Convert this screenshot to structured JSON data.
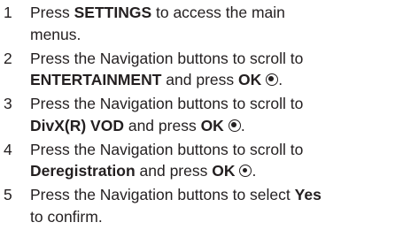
{
  "steps": [
    {
      "number": "1",
      "line1_a": "Press ",
      "line1_b": "SETTINGS",
      "line1_c": " to access the main",
      "line2": "menus."
    },
    {
      "number": "2",
      "line1": "Press the Navigation buttons to scroll to",
      "line2_a": "ENTERTAINMENT",
      "line2_b": " and press ",
      "line2_c": "OK",
      "line2_d": "."
    },
    {
      "number": "3",
      "line1": "Press the Navigation buttons to scroll to",
      "line2_a": "DivX(R) VOD",
      "line2_b": " and press ",
      "line2_c": "OK",
      "line2_d": "."
    },
    {
      "number": "4",
      "line1": "Press the Navigation buttons to scroll to",
      "line2_a": "Deregistration",
      "line2_b": " and press ",
      "line2_c": "OK",
      "line2_d": "."
    },
    {
      "number": "5",
      "line1_a": "Press the Navigation buttons to select ",
      "line1_b": "Yes",
      "line2": "to confirm."
    }
  ],
  "icons": {
    "ok": "ok-button-icon"
  }
}
